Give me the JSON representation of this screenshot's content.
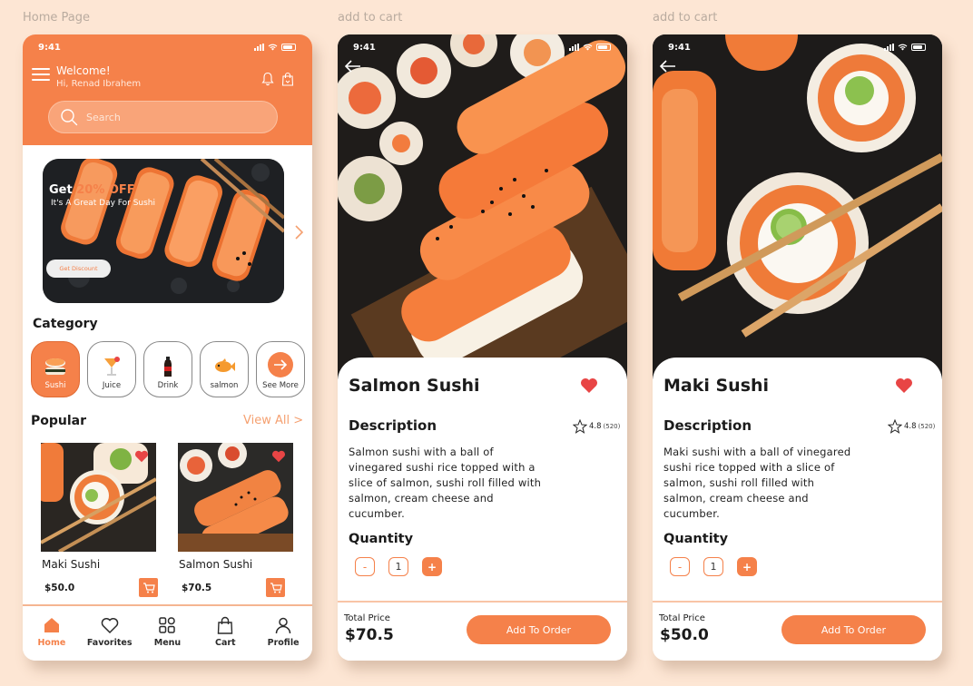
{
  "labels": {
    "home": "Home Page",
    "cart1": "add to cart",
    "cart2": "add to cart"
  },
  "status_time": "9:41",
  "home": {
    "welcome": "Welcome!",
    "user": "Hi, Renad Ibrahem",
    "search_placeholder": "Search",
    "banner": {
      "title_prefix": "Get ",
      "title_highlight": "20% OFF",
      "subtitle": "It's A Great Day For Sushi",
      "button": "Get Discount"
    },
    "category_title": "Category",
    "categories": [
      {
        "label": "Sushi",
        "icon": "sushi-icon",
        "active": true
      },
      {
        "label": "Juice",
        "icon": "cocktail-icon"
      },
      {
        "label": "Drink",
        "icon": "bottle-icon"
      },
      {
        "label": "salmon",
        "icon": "fish-icon"
      },
      {
        "label": "See More",
        "icon": "arrow-right-icon"
      }
    ],
    "popular_title": "Popular",
    "view_all": "View All  >",
    "products": [
      {
        "name": "Maki Sushi",
        "price": "$50.0"
      },
      {
        "name": "Salmon Sushi",
        "price": "$70.5"
      }
    ],
    "nav": [
      {
        "label": "Home",
        "icon": "home-icon",
        "active": true
      },
      {
        "label": "Favorites",
        "icon": "heart-icon"
      },
      {
        "label": "Menu",
        "icon": "grid-icon"
      },
      {
        "label": "Cart",
        "icon": "bag-icon"
      },
      {
        "label": "Profile",
        "icon": "user-icon"
      }
    ]
  },
  "details": [
    {
      "title": "Salmon Sushi",
      "desc_heading": "Description",
      "rating": "4.8",
      "rating_count": "(520)",
      "description": "Salmon sushi with a ball of vinegared sushi rice topped with a slice of salmon,  sushi roll filled with salmon, cream cheese and cucumber.",
      "qty_heading": "Quantity",
      "qty": "1",
      "total_label": "Total Price",
      "total": "$70.5",
      "button": "Add To Order"
    },
    {
      "title": "Maki Sushi",
      "desc_heading": "Description",
      "rating": "4.8",
      "rating_count": "(520)",
      "description": "Maki sushi with a ball of vinegared sushi rice topped with a slice of salmon,  sushi roll filled with salmon, cream cheese and cucumber.",
      "qty_heading": "Quantity",
      "qty": "1",
      "total_label": "Total Price",
      "total": "$50.0",
      "button": "Add To Order"
    }
  ],
  "colors": {
    "accent": "#f5814a",
    "background": "#fde6d4",
    "heart": "#e84545"
  }
}
